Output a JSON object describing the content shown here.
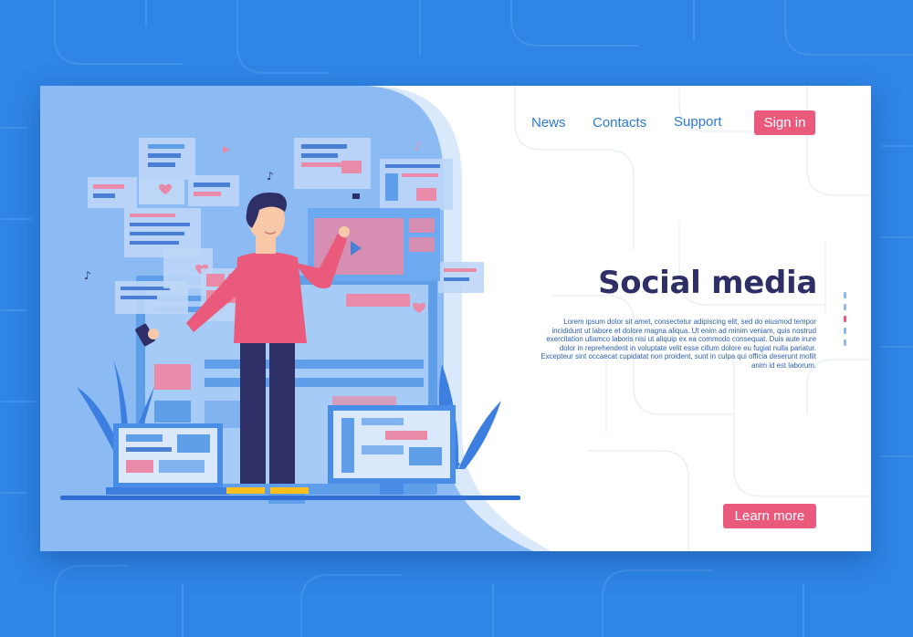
{
  "nav": {
    "items": [
      {
        "label": "News"
      },
      {
        "label": "Contacts"
      },
      {
        "label": "Support"
      }
    ],
    "signin_label": "Sign in"
  },
  "hero": {
    "title": "Social media",
    "body": "Lorem ipsum dolor sit amet, consectetur adipiscing elit, sed do eiusmod tempor incididunt ut labore et dolore magna aliqua. Ut enim ad minim veniam, quis nostrud exercitation ullamco laboris nisi ut aliquip ex ea commodo consequat. Duis aute irure dolor in reprehenderit in voluptate velit esse cillum dolore eu fugiat nulla pariatur. Excepteur sint occaecat cupidatat non proident, sunt in culpa qui officia deserunt mollit anim id est laborum.",
    "cta_label": "Learn more"
  },
  "pagination": {
    "count": 5,
    "active": 2
  },
  "colors": {
    "background": "#2f86e6",
    "accent": "#ea5a7c",
    "title": "#2e2f66",
    "link": "#2b7bd6",
    "panel": "#8cbaf2"
  }
}
